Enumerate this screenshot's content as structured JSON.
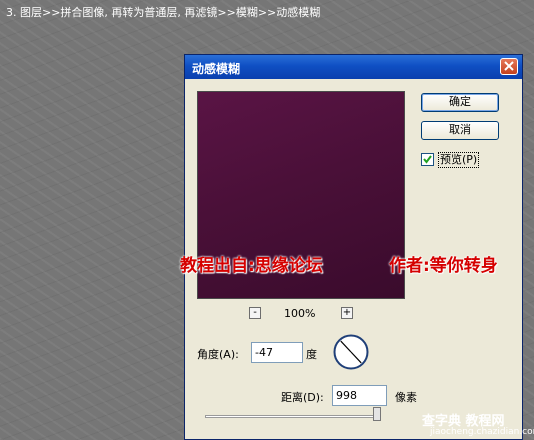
{
  "caption": "3. 图层>>拼合图像, 再转为普通层, 再滤镜>>模糊>>动感模糊",
  "dialog": {
    "title": "动感模糊",
    "ok_label": "确定",
    "cancel_label": "取消",
    "preview_checkbox": {
      "label": "预览(P)",
      "checked": true
    },
    "zoom": {
      "minus": "-",
      "plus": "+",
      "level": "100%"
    },
    "angle": {
      "label": "角度(A):",
      "value": "-47",
      "unit": "度"
    },
    "distance": {
      "label": "距离(D):",
      "value": "998",
      "unit": "像素",
      "slider_fraction": 0.998
    }
  },
  "overlay": {
    "left": "教程出自:思缘论坛",
    "right": "作者:等你转身"
  },
  "watermark": {
    "main": "查字典 教程网",
    "url": "jiaocheng.chazidian.com"
  },
  "colors": {
    "titlebar": "#0a3fae",
    "preview": "#4a1038",
    "overlay_text": "#d50000",
    "dialog_bg": "#ece9d8"
  }
}
